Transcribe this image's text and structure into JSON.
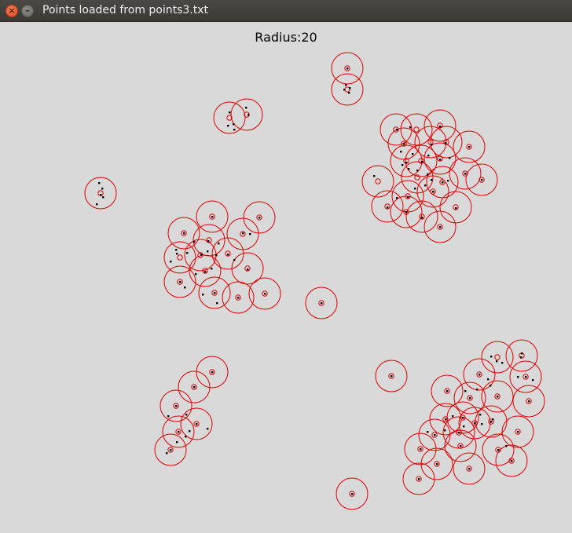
{
  "window": {
    "title": "Points loaded from points3.txt",
    "close_glyph": "×",
    "minimize_glyph": "–",
    "close_icon": "close-icon",
    "minimize_icon": "minimize-icon"
  },
  "canvas": {
    "radius_label": "Radius:20",
    "circle_color": "#e00000",
    "point_color": "#000000"
  }
}
